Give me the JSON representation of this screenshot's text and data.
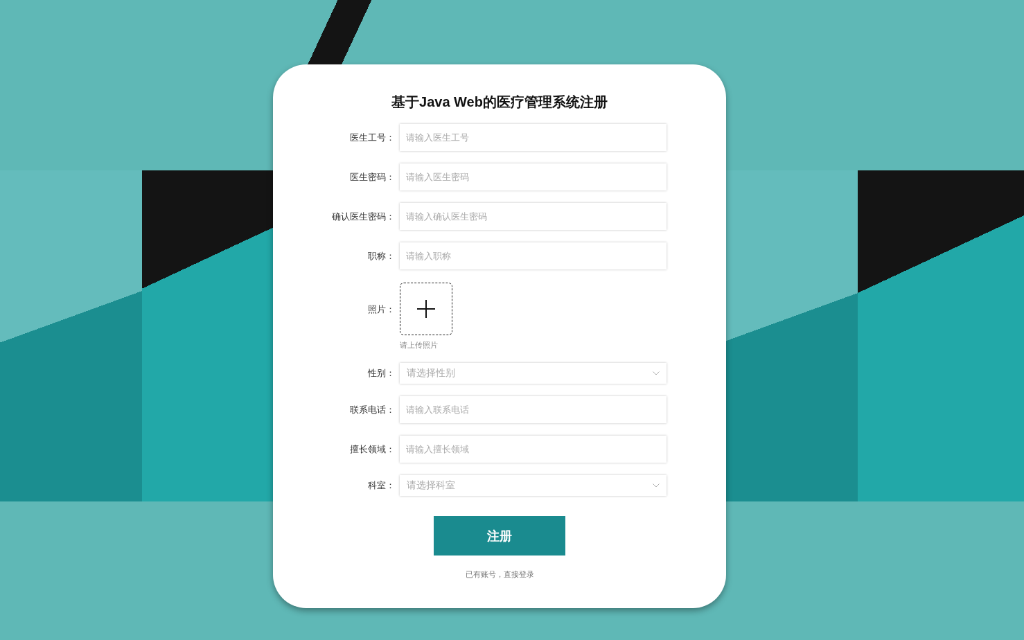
{
  "title": "基于Java Web的医疗管理系统注册",
  "fields": [
    {
      "kind": "input",
      "label": "医生工号：",
      "placeholder": "请输入医生工号"
    },
    {
      "kind": "input",
      "label": "医生密码：",
      "placeholder": "请输入医生密码"
    },
    {
      "kind": "input",
      "label": "确认医生密码：",
      "placeholder": "请输入确认医生密码"
    },
    {
      "kind": "input",
      "label": "职称：",
      "placeholder": "请输入职称"
    },
    {
      "kind": "upload",
      "label": "照片：",
      "hint": "请上传照片"
    },
    {
      "kind": "select",
      "label": "性别：",
      "placeholder": "请选择性别"
    },
    {
      "kind": "input",
      "label": "联系电话：",
      "placeholder": "请输入联系电话"
    },
    {
      "kind": "input",
      "label": "擅长领域：",
      "placeholder": "请输入擅长领域"
    },
    {
      "kind": "select",
      "label": "科室：",
      "placeholder": "请选择科室"
    }
  ],
  "submit": "注册",
  "login_link": "已有账号，直接登录"
}
